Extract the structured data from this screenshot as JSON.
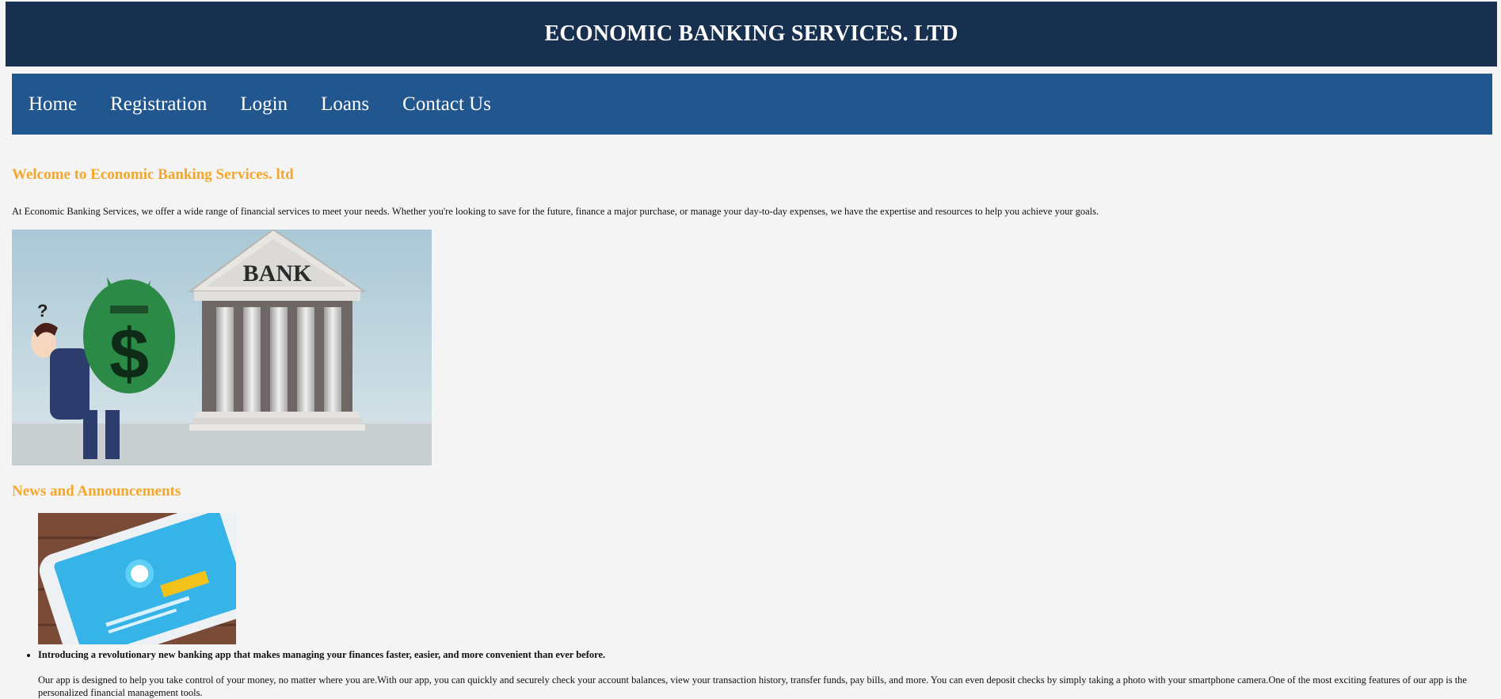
{
  "header": {
    "title": "ECONOMIC BANKING SERVICES. LTD"
  },
  "nav": {
    "items": [
      {
        "label": "Home"
      },
      {
        "label": "Registration"
      },
      {
        "label": "Login"
      },
      {
        "label": "Loans"
      },
      {
        "label": "Contact Us"
      }
    ]
  },
  "welcome": {
    "title": "Welcome to Economic Banking Services. ltd",
    "text": "At Economic Banking Services, we offer a wide range of financial services to meet your needs. Whether you're looking to save for the future, finance a major purchase, or manage your day-to-day expenses, we have the expertise and resources to help you achieve your goals.",
    "image_sign": "BANK"
  },
  "news": {
    "title": "News and Announcements",
    "items": [
      {
        "headline": "Introducing a revolutionary new banking app that makes managing your finances faster, easier, and more convenient than ever before.",
        "body": "Our app is designed to help you take control of your money, no matter where you are.With our app, you can quickly and securely check your account balances, view your transaction history, transfer funds, pay bills, and more. You can even deposit checks by simply taking a photo with your smartphone camera.One of the most exciting features of our app is the personalized financial management tools."
      }
    ]
  },
  "colors": {
    "header_bg": "#17304f",
    "nav_bg": "#21568e",
    "accent": "#f4a72a",
    "page_bg": "#f4f4f4"
  }
}
